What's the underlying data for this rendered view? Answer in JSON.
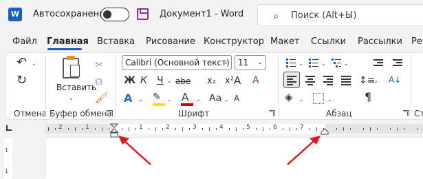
{
  "titlebar": {
    "logo": "W",
    "autosave_label": "Автосохранение",
    "document_title": "Документ1 - Word",
    "search_placeholder": "Поиск (Alt+Ы)"
  },
  "tabs": [
    "Файл",
    "Главная",
    "Вставка",
    "Рисование",
    "Конструктор",
    "Макет",
    "Ссылки",
    "Рассылки",
    "Ре"
  ],
  "active_tab": "Главная",
  "ribbon": {
    "groups": {
      "undo": "Отмена",
      "clipboard": "Буфер обмена",
      "font": "Шрифт",
      "paragraph": "Абзац",
      "styles": "Ст"
    },
    "paste_label": "Вставить",
    "font_name": "Calibri (Основной текст)",
    "font_size": "11",
    "format_buttons": {
      "bold": "Ж",
      "italic": "К",
      "underline": "Ч",
      "strike": "abe",
      "subscript": "x₂",
      "superscript": "x²",
      "text_effects": "A",
      "highlight": "✎",
      "font_color": "A",
      "case": "Aa",
      "grow": "A",
      "shrink": "A",
      "clear": "A"
    },
    "paragraph_glyphs": {
      "sort": "A↓",
      "pilcrow": "¶"
    }
  },
  "ruler": {
    "numbers": [
      "2",
      "1",
      "1",
      "2",
      "3",
      "4",
      "5",
      "6",
      "7"
    ],
    "vertical_numbers": [
      "1",
      "1"
    ]
  },
  "colors": {
    "accent": "#1b5fbd",
    "highlight": "#ffe000",
    "font_color": "#d00000",
    "arrow": "#e0151d"
  },
  "icons": [
    "word-logo-icon",
    "save-icon",
    "search-icon",
    "undo-icon",
    "redo-icon",
    "paste-icon",
    "cut-icon",
    "copy-icon",
    "format-painter-icon"
  ]
}
